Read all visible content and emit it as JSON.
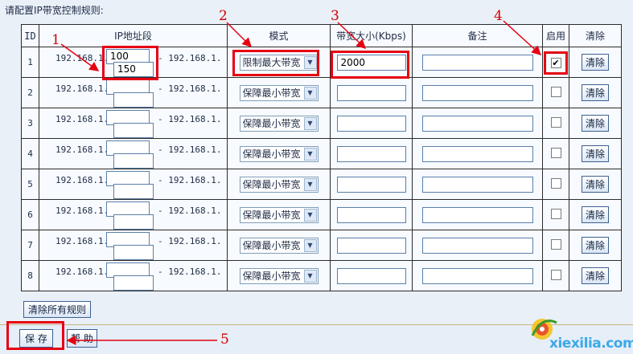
{
  "page_title": "请配置IP带宽控制规则:",
  "columns": {
    "id": "ID",
    "ip_range": "IP地址段",
    "mode": "模式",
    "bandwidth": "带宽大小(Kbps)",
    "note": "备注",
    "enable": "启用",
    "clear": "清除"
  },
  "ip_prefix": "192.168.1.",
  "ip_dash": "- 192.168.1.",
  "rows": [
    {
      "id": "1",
      "ip_start": "100",
      "ip_end": "150",
      "mode": "限制最大带宽",
      "bandwidth": "2000",
      "note": "",
      "enabled": true,
      "clear_label": "清除"
    },
    {
      "id": "2",
      "ip_start": "",
      "ip_end": "",
      "mode": "保障最小带宽",
      "bandwidth": "",
      "note": "",
      "enabled": false,
      "clear_label": "清除"
    },
    {
      "id": "3",
      "ip_start": "",
      "ip_end": "",
      "mode": "保障最小带宽",
      "bandwidth": "",
      "note": "",
      "enabled": false,
      "clear_label": "清除"
    },
    {
      "id": "4",
      "ip_start": "",
      "ip_end": "",
      "mode": "保障最小带宽",
      "bandwidth": "",
      "note": "",
      "enabled": false,
      "clear_label": "清除"
    },
    {
      "id": "5",
      "ip_start": "",
      "ip_end": "",
      "mode": "保障最小带宽",
      "bandwidth": "",
      "note": "",
      "enabled": false,
      "clear_label": "清除"
    },
    {
      "id": "6",
      "ip_start": "",
      "ip_end": "",
      "mode": "保障最小带宽",
      "bandwidth": "",
      "note": "",
      "enabled": false,
      "clear_label": "清除"
    },
    {
      "id": "7",
      "ip_start": "",
      "ip_end": "",
      "mode": "保障最小带宽",
      "bandwidth": "",
      "note": "",
      "enabled": false,
      "clear_label": "清除"
    },
    {
      "id": "8",
      "ip_start": "",
      "ip_end": "",
      "mode": "保障最小带宽",
      "bandwidth": "",
      "note": "",
      "enabled": false,
      "clear_label": "清除"
    }
  ],
  "buttons": {
    "clear_all": "清除所有规则",
    "save": "保 存",
    "help": "帮 助"
  },
  "annotations": [
    "1",
    "2",
    "3",
    "4",
    "5"
  ],
  "watermark": {
    "text": "xiexilia.com"
  },
  "colors": {
    "annotation_red": "#e60012",
    "background": "#e9f0f8",
    "watermark_blue": "#3da9e8"
  },
  "icons": {
    "dropdown": "chevron-down-icon",
    "checkbox_checked": "check-icon"
  }
}
